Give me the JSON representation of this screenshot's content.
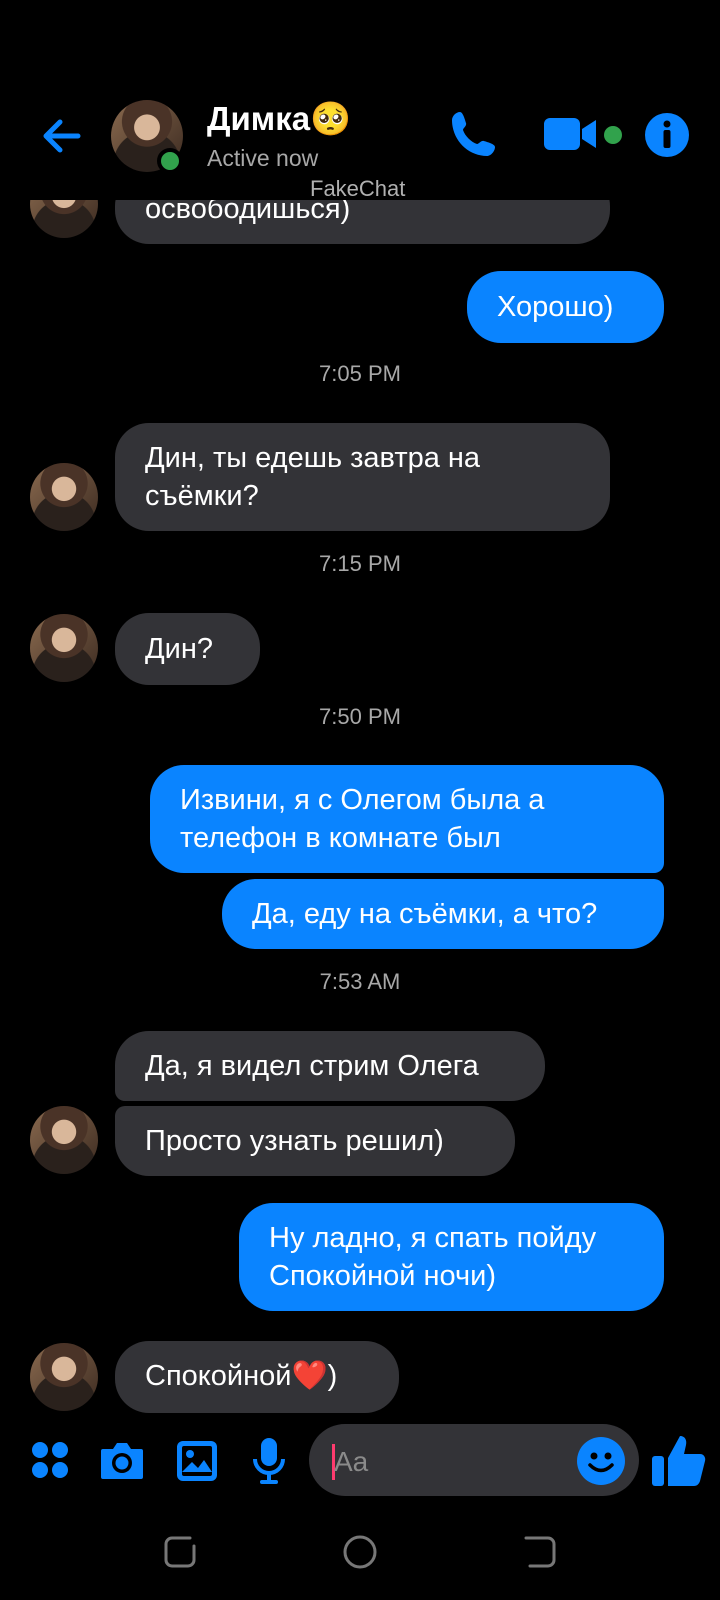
{
  "header": {
    "contact_name": "Димка🥺",
    "status": "Active now",
    "watermark": "FakeChat"
  },
  "messages": [
    {
      "side": "in",
      "text": "освободишься)"
    },
    {
      "side": "out",
      "text": "Хорошо)"
    },
    {
      "type": "time",
      "text": "7:05 PM"
    },
    {
      "side": "in",
      "text": "Дин, ты едешь завтра на съёмки?"
    },
    {
      "type": "time",
      "text": "7:15 PM"
    },
    {
      "side": "in",
      "text": "Дин?"
    },
    {
      "type": "time",
      "text": "7:50 PM"
    },
    {
      "side": "out",
      "text": "Извини, я с Олегом была а телефон в комнате был"
    },
    {
      "side": "out",
      "text": "Да, еду на съёмки, а что?"
    },
    {
      "type": "time",
      "text": "7:53 AM"
    },
    {
      "side": "in",
      "text": "Да, я видел стрим Олега"
    },
    {
      "side": "in",
      "text": "Просто узнать решил)"
    },
    {
      "side": "out",
      "text": "Ну ладно, я спать пойду Спокойной ночи)"
    },
    {
      "side": "in",
      "text": "Спокойной❤️)"
    }
  ],
  "composer": {
    "placeholder": "Aa",
    "icons": [
      "apps-icon",
      "camera-icon",
      "gallery-icon",
      "microphone-icon",
      "emoji-icon",
      "thumbs-up-icon"
    ]
  },
  "colors": {
    "accent": "#0a84ff",
    "incoming_bubble": "#333337",
    "online": "#31a24c"
  }
}
